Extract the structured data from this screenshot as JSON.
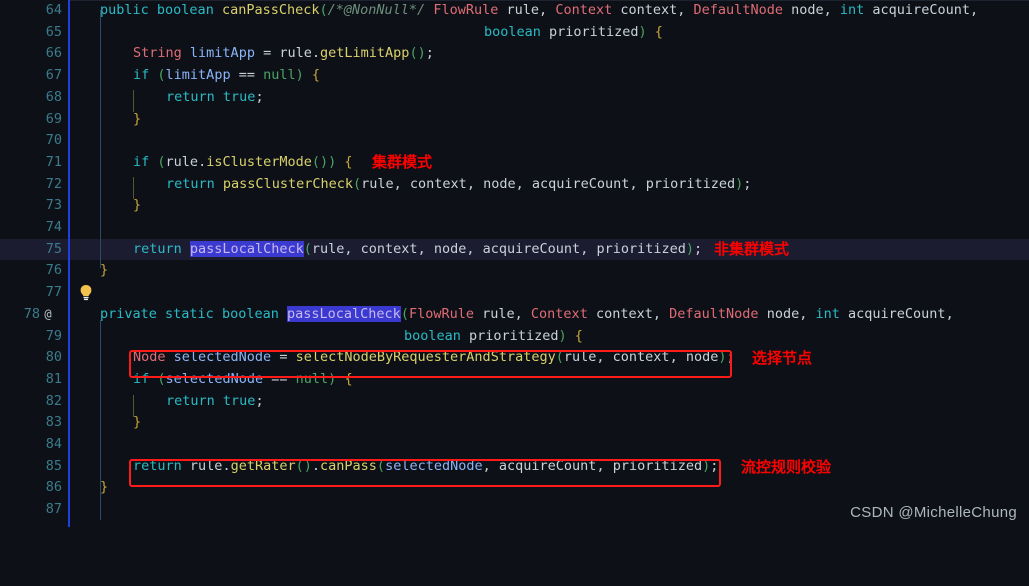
{
  "editor": {
    "first_line": 64,
    "language": "java",
    "background": "#0d1117",
    "current_line": 75,
    "selection_token": "passLocalCheck",
    "gutter_marker_color": "#1f3fe0"
  },
  "lines": [
    {
      "num": "64",
      "marker": "",
      "code": "    public boolean canPassCheck(/*@NonNull*/ FlowRule rule, Context context, DefaultNode node, int acquireCount,"
    },
    {
      "num": "65",
      "marker": "",
      "code": "                                boolean prioritized) {"
    },
    {
      "num": "66",
      "marker": "",
      "code": "        String limitApp = rule.getLimitApp();"
    },
    {
      "num": "67",
      "marker": "",
      "code": "        if (limitApp == null) {"
    },
    {
      "num": "68",
      "marker": "",
      "code": "            return true;"
    },
    {
      "num": "69",
      "marker": "",
      "code": "        }"
    },
    {
      "num": "70",
      "marker": "",
      "code": ""
    },
    {
      "num": "71",
      "marker": "",
      "code": "        if (rule.isClusterMode()) {"
    },
    {
      "num": "72",
      "marker": "",
      "code": "            return passClusterCheck(rule, context, node, acquireCount, prioritized);"
    },
    {
      "num": "73",
      "marker": "",
      "code": "        }"
    },
    {
      "num": "74",
      "marker": "",
      "code": ""
    },
    {
      "num": "75",
      "marker": "bulb",
      "code": "        return passLocalCheck(rule, context, node, acquireCount, prioritized);"
    },
    {
      "num": "76",
      "marker": "",
      "code": "    }"
    },
    {
      "num": "77",
      "marker": "",
      "code": ""
    },
    {
      "num": "78",
      "marker": "@",
      "code": "    private static boolean passLocalCheck(FlowRule rule, Context context, DefaultNode node, int acquireCount,"
    },
    {
      "num": "79",
      "marker": "",
      "code": "                                 boolean prioritized) {"
    },
    {
      "num": "80",
      "marker": "",
      "code": "        Node selectedNode = selectNodeByRequesterAndStrategy(rule, context, node);"
    },
    {
      "num": "81",
      "marker": "",
      "code": "        if (selectedNode == null) {"
    },
    {
      "num": "82",
      "marker": "",
      "code": "            return true;"
    },
    {
      "num": "83",
      "marker": "",
      "code": "        }"
    },
    {
      "num": "84",
      "marker": "",
      "code": ""
    },
    {
      "num": "85",
      "marker": "",
      "code": "        return rule.getRater().canPass(selectedNode, acquireCount, prioritized);"
    },
    {
      "num": "86",
      "marker": "",
      "code": "    }"
    },
    {
      "num": "87",
      "marker": "",
      "code": ""
    }
  ],
  "annotations": [
    {
      "text": "集群模式",
      "line": 71,
      "note": "cluster mode"
    },
    {
      "text": "非集群模式",
      "line": 75,
      "note": "non-cluster mode"
    },
    {
      "text": "选择节点",
      "line": 80,
      "note": "select node"
    },
    {
      "text": "流控规则校验",
      "line": 85,
      "note": "flow control rule check"
    }
  ],
  "highlight_boxes": [
    {
      "line": 80,
      "color": "#ff1a1a"
    },
    {
      "line": 85,
      "color": "#ff1a1a"
    }
  ],
  "watermark": {
    "text": "CSDN @MichelleChung"
  }
}
